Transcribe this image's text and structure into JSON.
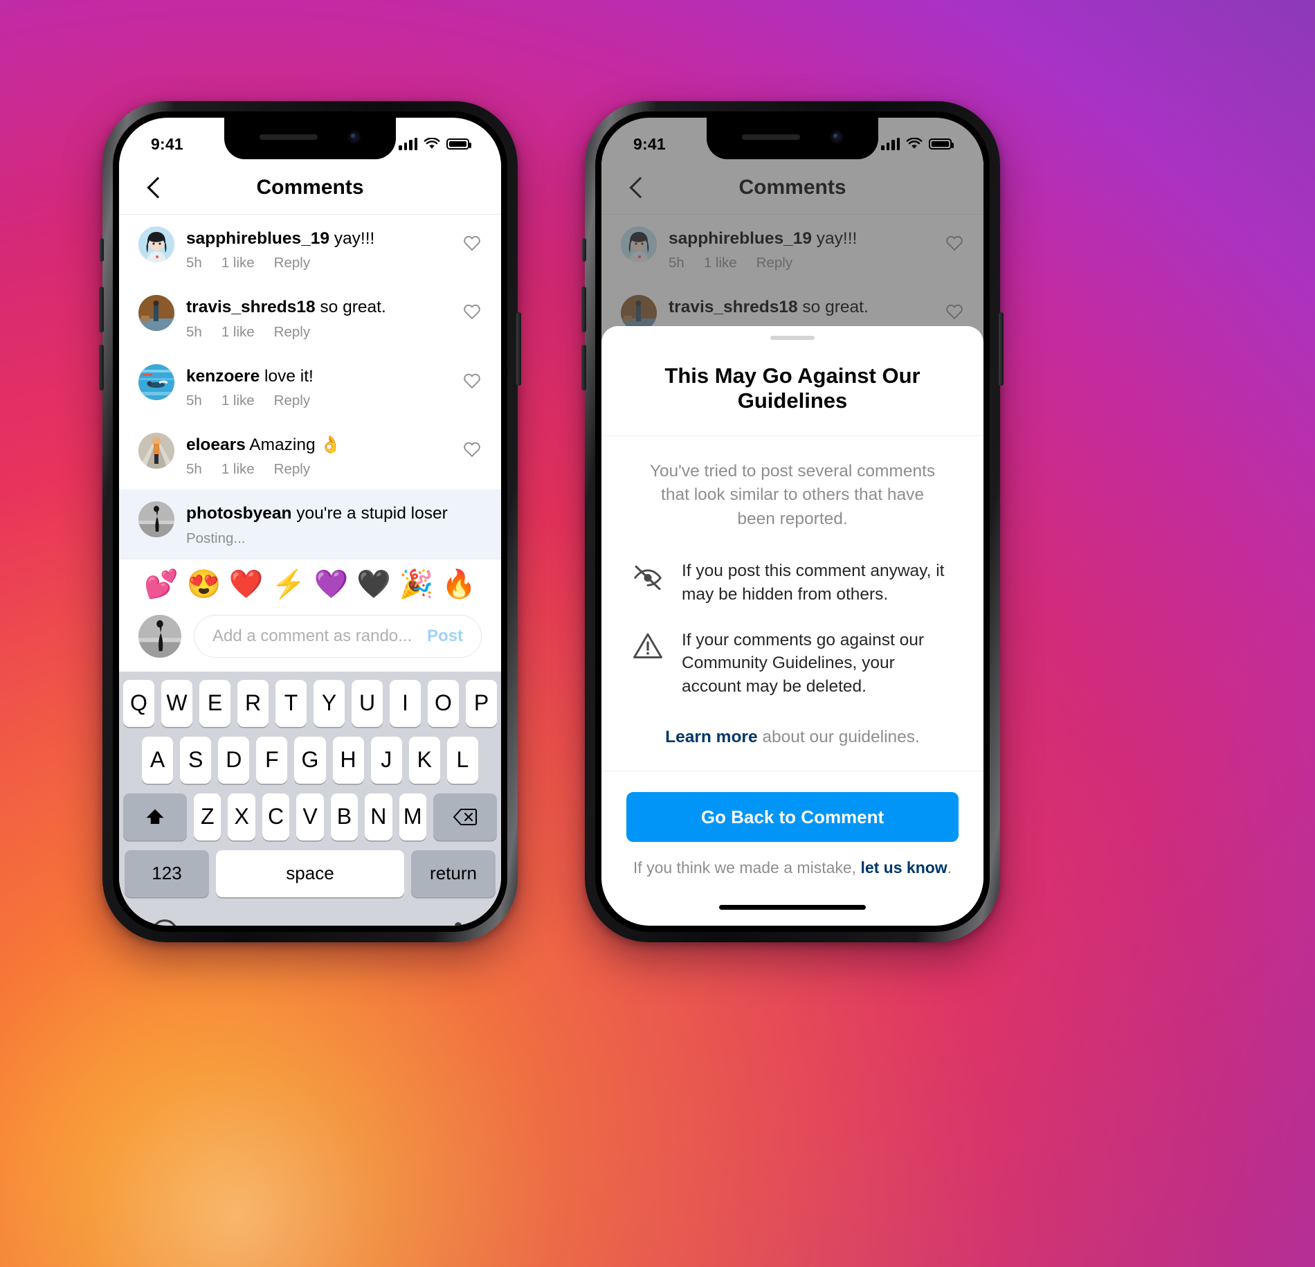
{
  "theme": {
    "accent_blue": "#0095f6",
    "link_blue": "#00376b",
    "muted_gray": "#8e8e8e",
    "pending_highlight": "#eef4fa"
  },
  "status_bar": {
    "time": "9:41",
    "signal_icon": "cellular-bars-icon",
    "wifi_icon": "wifi-icon",
    "battery_icon": "battery-full-icon"
  },
  "nav": {
    "back_icon": "back-chevron-icon",
    "title": "Comments"
  },
  "comments": [
    {
      "avatar": "avatar-sapphireblues",
      "username": "sapphireblues_19",
      "text": "yay!!!",
      "time": "5h",
      "likes": "1 like",
      "reply": "Reply",
      "like_icon": "heart-outline-icon"
    },
    {
      "avatar": "avatar-travis",
      "username": "travis_shreds18",
      "text": "so great.",
      "time": "5h",
      "likes": "1 like",
      "reply": "Reply",
      "like_icon": "heart-outline-icon"
    },
    {
      "avatar": "avatar-kenzoere",
      "username": "kenzoere",
      "text": "love it!",
      "time": "5h",
      "likes": "1 like",
      "reply": "Reply",
      "like_icon": "heart-outline-icon"
    },
    {
      "avatar": "avatar-eloears",
      "username": "eloears",
      "text": "Amazing 👌",
      "time": "5h",
      "likes": "1 like",
      "reply": "Reply",
      "like_icon": "heart-outline-icon"
    }
  ],
  "pending_comment": {
    "avatar": "avatar-photosbyean",
    "username": "photosbyean",
    "text": "you're a stupid loser",
    "status": "Posting..."
  },
  "emoji_bar": [
    {
      "name": "two-hearts-emoji",
      "glyph": "💕"
    },
    {
      "name": "heart-eyes-emoji",
      "glyph": "😍"
    },
    {
      "name": "red-heart-emoji",
      "glyph": "❤️"
    },
    {
      "name": "high-voltage-emoji",
      "glyph": "⚡"
    },
    {
      "name": "purple-heart-emoji",
      "glyph": "💜"
    },
    {
      "name": "black-heart-emoji",
      "glyph": "🖤"
    },
    {
      "name": "party-popper-emoji",
      "glyph": "🎉"
    },
    {
      "name": "fire-emoji",
      "glyph": "🔥"
    }
  ],
  "comment_input": {
    "avatar": "avatar-photosbyean",
    "placeholder": "Add a comment as rando...",
    "value": "",
    "post_label": "Post"
  },
  "keyboard": {
    "row1": [
      "Q",
      "W",
      "E",
      "R",
      "T",
      "Y",
      "U",
      "I",
      "O",
      "P"
    ],
    "row2": [
      "A",
      "S",
      "D",
      "F",
      "G",
      "H",
      "J",
      "K",
      "L"
    ],
    "row3": [
      "Z",
      "X",
      "C",
      "V",
      "B",
      "N",
      "M"
    ],
    "shift_icon": "shift-arrow-icon",
    "backspace_icon": "backspace-icon",
    "numbers_label": "123",
    "space_label": "space",
    "return_label": "return",
    "emoji_key_icon": "emoji-smiley-icon",
    "mic_key_icon": "microphone-icon"
  },
  "modal": {
    "grabber": "sheet-grabber",
    "title": "This May Go Against Our Guidelines",
    "description": "You've tried to post several comments that look similar to others that have been reported.",
    "bullets": [
      {
        "icon": "eye-slash-icon",
        "text": "If you post this comment anyway, it may be hidden from others."
      },
      {
        "icon": "warning-triangle-icon",
        "text": "If your comments go against our Community Guidelines, your account may be deleted."
      }
    ],
    "learn_more_link": "Learn more",
    "learn_more_rest": " about our guidelines.",
    "cta_label": "Go Back to Comment",
    "footer_prefix": "If you think we made a mistake, ",
    "footer_link": "let us know",
    "footer_suffix": "."
  }
}
